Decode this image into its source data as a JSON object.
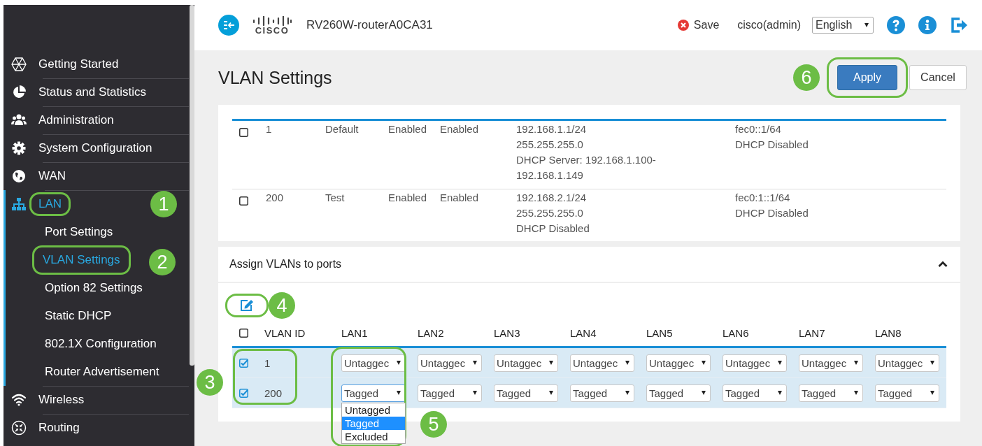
{
  "header": {
    "logo_text": "CISCO",
    "device_name": "RV260W-routerA0CA31",
    "save_label": "Save",
    "user": "cisco(admin)",
    "language": "English"
  },
  "sidebar": {
    "items": [
      {
        "label": "Getting Started",
        "selected": false
      },
      {
        "label": "Status and Statistics",
        "selected": false
      },
      {
        "label": "Administration",
        "selected": false
      },
      {
        "label": "System Configuration",
        "selected": false
      },
      {
        "label": "WAN",
        "selected": false
      },
      {
        "label": "LAN",
        "selected": true,
        "callout": "1",
        "children": [
          {
            "label": "Port Settings",
            "selected": false
          },
          {
            "label": "VLAN Settings",
            "selected": true,
            "callout": "2"
          },
          {
            "label": "Option 82 Settings",
            "selected": false
          },
          {
            "label": "Static DHCP",
            "selected": false
          },
          {
            "label": "802.1X Configuration",
            "selected": false
          },
          {
            "label": "Router Advertisement",
            "selected": false
          }
        ]
      },
      {
        "label": "Wireless",
        "selected": false
      },
      {
        "label": "Routing",
        "selected": false
      }
    ]
  },
  "page": {
    "title": "VLAN Settings",
    "buttons": [
      {
        "label": "Apply",
        "kind": "primary",
        "callout": "6"
      },
      {
        "label": "Cancel",
        "kind": "default"
      }
    ]
  },
  "vlan_table": {
    "rows": [
      {
        "checked": false,
        "cells": [
          [
            "1"
          ],
          [
            "Default"
          ],
          [
            "Enabled"
          ],
          [
            "Enabled"
          ],
          [
            "192.168.1.1/24",
            "255.255.255.0",
            "DHCP Server: 192.168.1.100-",
            "192.168.1.149"
          ],
          [
            "fec0::1/64",
            "DHCP Disabled"
          ]
        ]
      },
      {
        "checked": false,
        "cells": [
          [
            "200"
          ],
          [
            "Test"
          ],
          [
            "Enabled"
          ],
          [
            "Enabled"
          ],
          [
            "192.168.2.1/24",
            "255.255.255.0",
            "DHCP Disabled"
          ],
          [
            "fec0:1::1/64",
            "DHCP Disabled"
          ]
        ]
      }
    ]
  },
  "assign_ports": {
    "title": "Assign VLANs to ports",
    "expanded": true,
    "edit_callout": "4",
    "rows_callout": "3",
    "select_all_checked": false,
    "columns": [
      {
        "label": "VLAN ID"
      },
      {
        "label": "LAN1",
        "callout": "5"
      },
      {
        "label": "LAN2"
      },
      {
        "label": "LAN3"
      },
      {
        "label": "LAN4"
      },
      {
        "label": "LAN5"
      },
      {
        "label": "LAN6"
      },
      {
        "label": "LAN7"
      },
      {
        "label": "LAN8"
      }
    ],
    "rows": [
      {
        "checked": true,
        "vlan_id": "1",
        "ports": [
          {
            "value": "Untaggec",
            "open": false
          },
          {
            "value": "Untaggec",
            "open": false
          },
          {
            "value": "Untaggec",
            "open": false
          },
          {
            "value": "Untaggec",
            "open": false
          },
          {
            "value": "Untaggec",
            "open": false
          },
          {
            "value": "Untaggec",
            "open": false
          },
          {
            "value": "Untaggec",
            "open": false
          },
          {
            "value": "Untaggec",
            "open": false
          }
        ]
      },
      {
        "checked": true,
        "vlan_id": "200",
        "ports": [
          {
            "value": "Tagged",
            "open": true,
            "options": [
              {
                "label": "Untagged",
                "selected": false
              },
              {
                "label": "Tagged",
                "selected": true
              },
              {
                "label": "Excluded",
                "selected": false
              }
            ]
          },
          {
            "value": "Tagged",
            "open": false
          },
          {
            "value": "Tagged",
            "open": false
          },
          {
            "value": "Tagged",
            "open": false
          },
          {
            "value": "Tagged",
            "open": false
          },
          {
            "value": "Tagged",
            "open": false
          },
          {
            "value": "Tagged",
            "open": false
          },
          {
            "value": "Tagged",
            "open": false
          }
        ]
      }
    ]
  }
}
